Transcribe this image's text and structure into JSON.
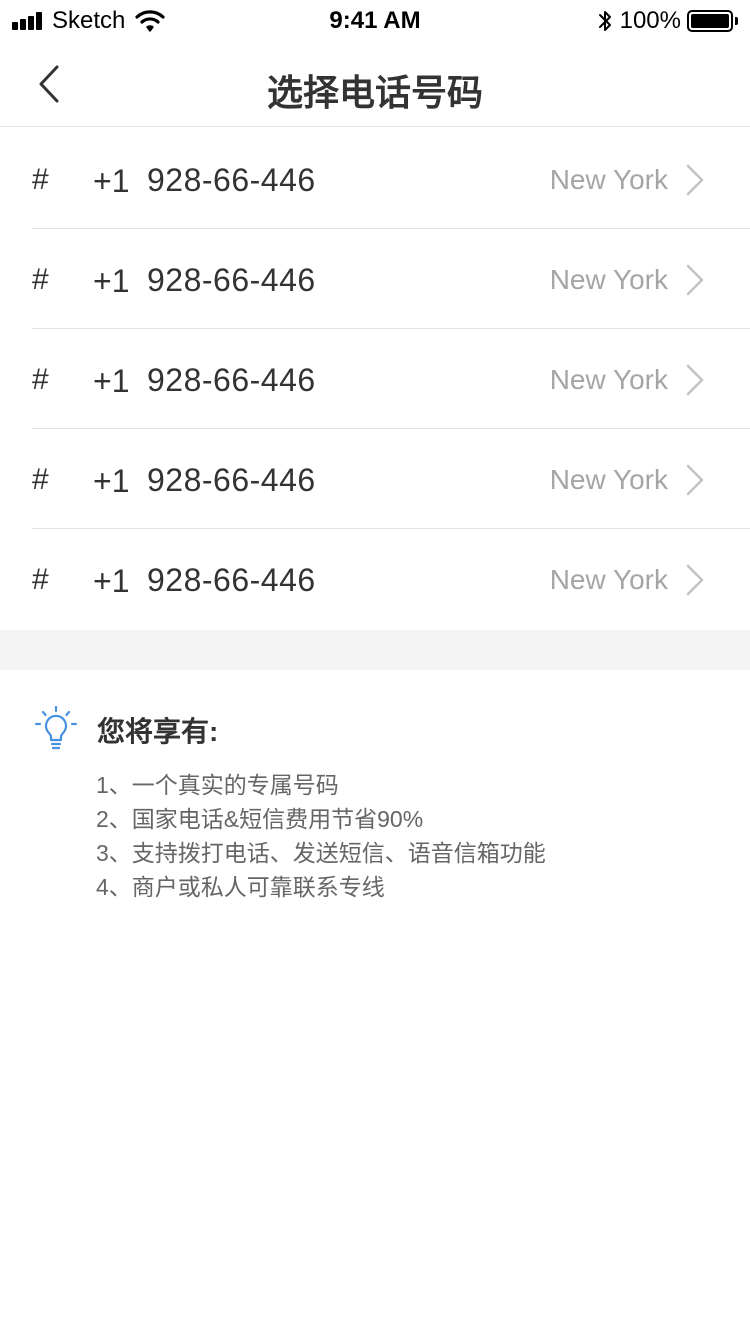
{
  "status_bar": {
    "carrier": "Sketch",
    "time": "9:41 AM",
    "battery": "100%"
  },
  "nav": {
    "title": "选择电话号码"
  },
  "numbers": [
    {
      "hash": "#",
      "prefix": "+1",
      "number": "928-66-446",
      "city": "New York"
    },
    {
      "hash": "#",
      "prefix": "+1",
      "number": "928-66-446",
      "city": "New York"
    },
    {
      "hash": "#",
      "prefix": "+1",
      "number": "928-66-446",
      "city": "New York"
    },
    {
      "hash": "#",
      "prefix": "+1",
      "number": "928-66-446",
      "city": "New York"
    },
    {
      "hash": "#",
      "prefix": "+1",
      "number": "928-66-446",
      "city": "New York"
    }
  ],
  "benefits": {
    "title": "您将享有:",
    "icon": "lightbulb-icon",
    "accent_color": "#4a90e2",
    "items": [
      "1、一个真实的专属号码",
      "2、国家电话&短信费用节省90%",
      "3、支持拨打电话、发送短信、语音信箱功能",
      "4、商户或私人可靠联系专线"
    ]
  }
}
